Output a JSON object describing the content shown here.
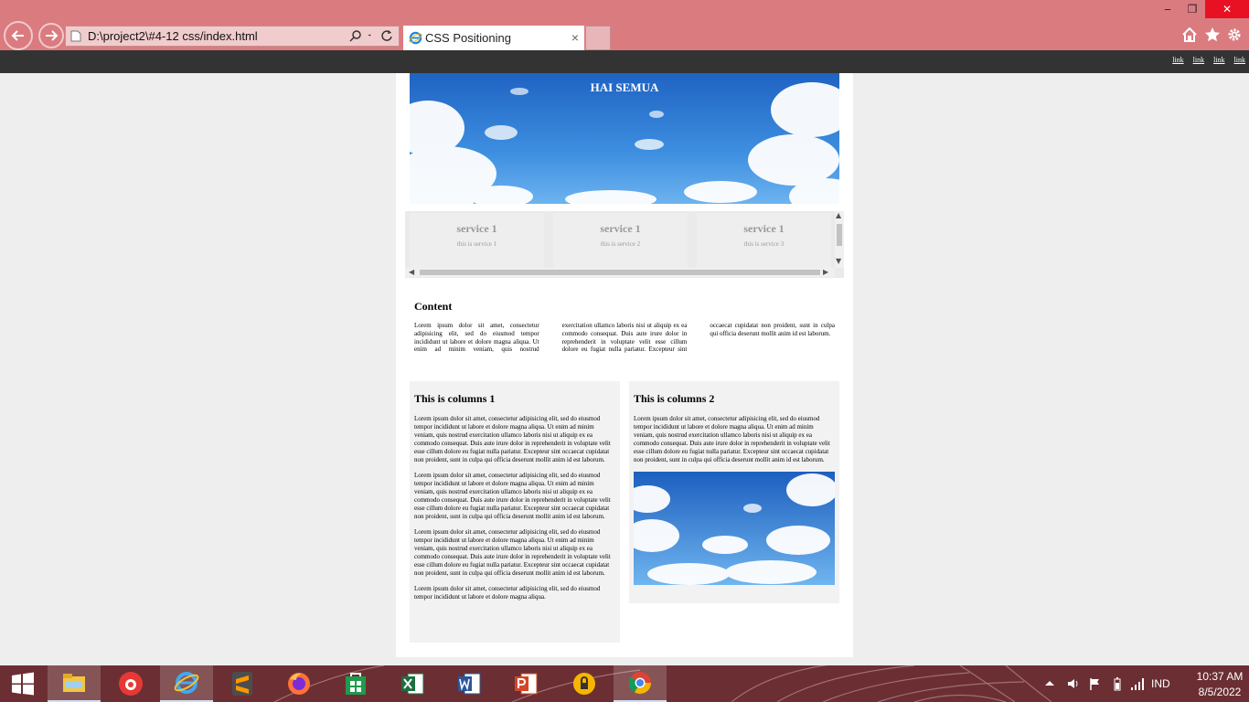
{
  "browser": {
    "address": "D:\\project2\\#4-12 css/index.html",
    "tab_title": "CSS Positioning",
    "tab_close": "×",
    "window_controls": {
      "minimize": "‒",
      "restore": "❐",
      "close": "✕"
    },
    "icons": [
      "back-arrow-icon",
      "forward-arrow-icon",
      "search-icon",
      "refresh-icon",
      "ie-icon",
      "home-icon",
      "favorites-star-icon",
      "settings-gear-icon"
    ]
  },
  "page": {
    "nav_links": [
      "link",
      "link",
      "link",
      "link"
    ],
    "hero_title": "HAI SEMUA",
    "services": [
      {
        "title": "service 1",
        "subtitle": "this is service 1"
      },
      {
        "title": "service 1",
        "subtitle": "this is service 2"
      },
      {
        "title": "service 1",
        "subtitle": "this is service 3"
      }
    ],
    "content": {
      "heading": "Content",
      "text": "Lorem ipsum dolor sit amet, consectetur adipisicing elit, sed do eiusmod tempor incididunt ut labore et dolore magna aliqua. Ut enim ad minim veniam, quis nostrud exercitation ullamco laboris nisi ut aliquip ex ea commodo consequat. Duis aute irure dolor in reprehenderit in voluptate velit esse cillum dolore eu fugiat nulla pariatur. Excepteur sint occaecat cupidatat non proident, sunt in culpa qui officia deserunt mollit anim id est laborum."
    },
    "column1": {
      "heading": "This is columns 1",
      "paragraphs": [
        "Lorem ipsum dolor sit amet, consectetur adipisicing elit, sed do eiusmod tempor incididunt ut labore et dolore magna aliqua. Ut enim ad minim veniam, quis nostrud exercitation ullamco laboris nisi ut aliquip ex ea commodo consequat. Duis aute irure dolor in reprehenderit in voluptate velit esse cillum dolore eu fugiat nulla pariatur. Excepteur sint occaecat cupidatat non proident, sunt in culpa qui officia deserunt mollit anim id est laborum.",
        "Lorem ipsum dolor sit amet, consectetur adipisicing elit, sed do eiusmod tempor incididunt ut labore et dolore magna aliqua. Ut enim ad minim veniam, quis nostrud exercitation ullamco laboris nisi ut aliquip ex ea commodo consequat. Duis aute irure dolor in reprehenderit in voluptate velit esse cillum dolore eu fugiat nulla pariatur. Excepteur sint occaecat cupidatat non proident, sunt in culpa qui officia deserunt mollit anim id est laborum.",
        "Lorem ipsum dolor sit amet, consectetur adipisicing elit, sed do eiusmod tempor incididunt ut labore et dolore magna aliqua. Ut enim ad minim veniam, quis nostrud exercitation ullamco laboris nisi ut aliquip ex ea commodo consequat. Duis aute irure dolor in reprehenderit in voluptate velit esse cillum dolore eu fugiat nulla pariatur. Excepteur sint occaecat cupidatat non proident, sunt in culpa qui officia deserunt mollit anim id est laborum.",
        "Lorem ipsum dolor sit amet, consectetur adipisicing elit, sed do eiusmod tempor incididunt ut labore et dolore magna aliqua."
      ]
    },
    "column2": {
      "heading": "This is columns 2",
      "paragraph": "Lorem ipsum dolor sit amet, consectetur adipisicing elit, sed do eiusmod tempor incididunt ut labore et dolore magna aliqua. Ut enim ad minim veniam, quis nostrud exercitation ullamco laboris nisi ut aliquip ex ea commodo consequat. Duis aute irure dolor in reprehenderit in voluptate velit esse cillum dolore eu fugiat nulla pariatur. Excepteur sint occaecat cupidatat non proident, sunt in culpa qui officia deserunt mollit anim id est laborum."
    }
  },
  "taskbar": {
    "apps": [
      "file-explorer-icon",
      "screen-recorder-icon",
      "internet-explorer-icon",
      "sublime-text-icon",
      "firefox-icon",
      "store-icon",
      "excel-icon",
      "word-icon",
      "powerpoint-icon",
      "vpn-icon",
      "chrome-icon"
    ],
    "language": "IND",
    "time": "10:37 AM",
    "date": "8/5/2022"
  },
  "colors": {
    "chrome_bg": "#da7b80",
    "navbar_bg": "#333333",
    "page_bg": "#eeeeee",
    "taskbar_bg": "#6b2f33",
    "sky_blue": "#2f7bd3"
  }
}
